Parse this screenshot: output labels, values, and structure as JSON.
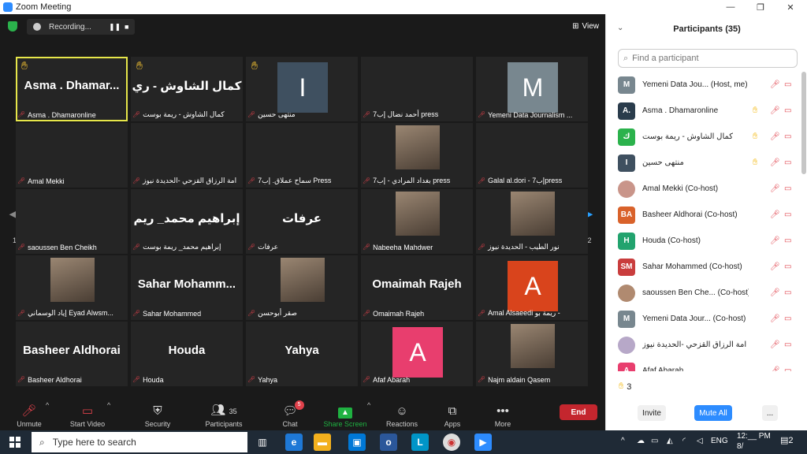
{
  "window": {
    "title": "Zoom Meeting",
    "minimize": "—",
    "restore": "❐",
    "close": "✕"
  },
  "topbar": {
    "recording_label": "Recording...",
    "pause": "❚❚",
    "stop": "■",
    "view_label": "View"
  },
  "pagination": {
    "left": "1/2",
    "right": "1/2"
  },
  "tiles": [
    {
      "bigname": "Asma . Dhamar...",
      "label": "Asma . Dhamaronline",
      "hand": true,
      "active": true
    },
    {
      "bigname": "كمال الشاوش - ري",
      "label": "كمال الشاوش - ريمة بوست",
      "hand": true
    },
    {
      "avatar": "I",
      "avatar_color": "#3f5060",
      "label": "منتهى حسين",
      "hand": true
    },
    {
      "bigname": "",
      "label": "أحمد نضال إب7 press"
    },
    {
      "avatar": "M",
      "avatar_color": "#78878f",
      "label": "Yemeni Data Journalism ..."
    },
    {
      "bigname": "",
      "label": "Amal Mekki"
    },
    {
      "bigname": "",
      "label": "امة الرزاق القزحي -الحديدة نيوز"
    },
    {
      "bigname": "",
      "label": "سماح عملاق. إب7 Press"
    },
    {
      "photo": true,
      "label": "بغداد المرادي - إب7 press"
    },
    {
      "bigname": "",
      "label": "Galal al.dori - إب7press"
    },
    {
      "bigname": "",
      "label": "saoussen Ben Cheikh"
    },
    {
      "bigname": "إبراهيم محمد_ ريم",
      "label": "إبراهيم محمد_ ريمة بوست"
    },
    {
      "bigname": "عرفات",
      "label": "عرفات"
    },
    {
      "photo": true,
      "label": "Nabeeha Mahdwer"
    },
    {
      "photo": true,
      "label": "نور الطيب - الحديدة نيوز"
    },
    {
      "photo": true,
      "label": "إياد الوسماني Eyad Alwsm..."
    },
    {
      "bigname": "Sahar Mohamm...",
      "label": "Sahar Mohammed"
    },
    {
      "photo": true,
      "label": "صقر أبوحسن"
    },
    {
      "bigname": "Omaimah Rajeh",
      "label": "Omaimah Rajeh"
    },
    {
      "avatar": "A",
      "avatar_color": "#d9441c",
      "label": "Amal Alsaeedi ريمة بو -"
    },
    {
      "bigname": "Basheer Aldhorai",
      "label": "Basheer Aldhorai"
    },
    {
      "bigname": "Houda",
      "label": "Houda"
    },
    {
      "bigname": "Yahya",
      "label": "Yahya"
    },
    {
      "avatar": "A",
      "avatar_color": "#e83e6e",
      "label": "Afaf Abarah"
    },
    {
      "photo": true,
      "label": "Najm aldain Qasem"
    }
  ],
  "toolbar": {
    "unmute": "Unmute",
    "start_video": "Start Video",
    "security": "Security",
    "participants": "Participants",
    "participants_count": "35",
    "chat": "Chat",
    "chat_badge": "5",
    "share_screen": "Share Screen",
    "reactions": "Reactions",
    "apps": "Apps",
    "more": "More",
    "end": "End"
  },
  "panel": {
    "title": "Participants (35)",
    "search_placeholder": "Find a participant",
    "hand_count": "3",
    "invite": "Invite",
    "mute_all": "Mute All",
    "more": "..."
  },
  "participants": [
    {
      "initials": "M",
      "color": "#78878f",
      "name": "Yemeni Data Jou... (Host, me)"
    },
    {
      "initials": "A.",
      "color": "#2a3c4c",
      "name": "Asma . Dhamaronline",
      "hand": true
    },
    {
      "initials": "ك",
      "color": "#2bb24c",
      "name": "كمال الشاوش - ريمة بوست",
      "hand": true
    },
    {
      "initials": "I",
      "color": "#3f5060",
      "name": "منتهى حسين",
      "hand": true
    },
    {
      "initials": "",
      "color": "#c9958a",
      "name": "Amal Mekki (Co-host)"
    },
    {
      "initials": "BA",
      "color": "#d9622b",
      "name": "Basheer Aldhorai (Co-host)"
    },
    {
      "initials": "H",
      "color": "#22a36e",
      "name": "Houda (Co-host)"
    },
    {
      "initials": "SM",
      "color": "#c93d3d",
      "name": "Sahar Mohammed (Co-host)"
    },
    {
      "initials": "",
      "color": "#b08a70",
      "name": "saoussen Ben Che... (Co-host)"
    },
    {
      "initials": "M",
      "color": "#78878f",
      "name": "Yemeni Data Jour... (Co-host)"
    },
    {
      "initials": "",
      "color": "#b7a8c8",
      "name": "امة الرزاق القزحي -الحديدة نيوز"
    },
    {
      "initials": "A",
      "color": "#e83e6e",
      "name": "Afaf Abarah"
    }
  ],
  "taskbar": {
    "search_placeholder": "Type here to search",
    "lang": "ENG",
    "time": "12:__ PM",
    "date": "8/",
    "notifications": "2"
  }
}
